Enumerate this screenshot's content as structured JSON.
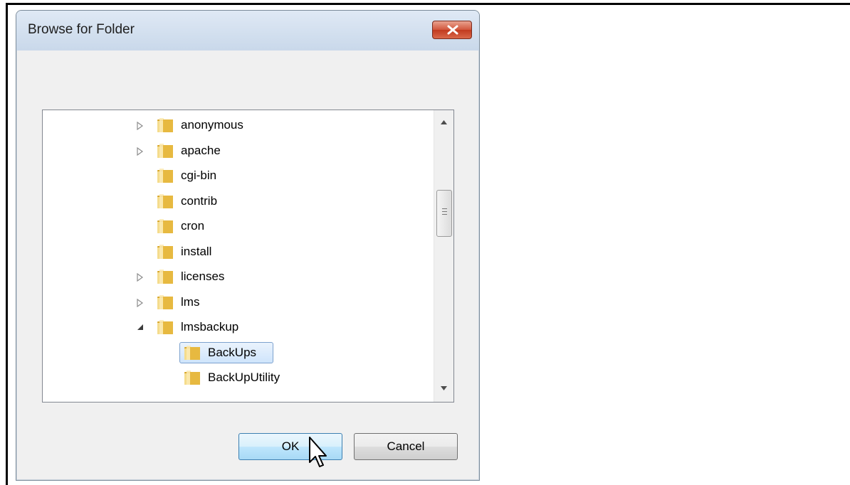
{
  "dialog": {
    "title": "Browse for Folder",
    "close_icon": "close-x-icon",
    "ok_label": "OK",
    "cancel_label": "Cancel"
  },
  "tree": {
    "items": [
      {
        "label": "anonymous",
        "expander": "collapsed",
        "indent": 0
      },
      {
        "label": "apache",
        "expander": "collapsed",
        "indent": 0
      },
      {
        "label": "cgi-bin",
        "expander": "none",
        "indent": 0
      },
      {
        "label": "contrib",
        "expander": "none",
        "indent": 0
      },
      {
        "label": "cron",
        "expander": "none",
        "indent": 0
      },
      {
        "label": "install",
        "expander": "none",
        "indent": 0
      },
      {
        "label": "licenses",
        "expander": "collapsed",
        "indent": 0
      },
      {
        "label": "lms",
        "expander": "collapsed",
        "indent": 0
      },
      {
        "label": "lmsbackup",
        "expander": "expanded",
        "indent": 0
      },
      {
        "label": "BackUps",
        "expander": "none",
        "indent": 1,
        "selected": true
      },
      {
        "label": "BackUpUtility",
        "expander": "none",
        "indent": 1
      }
    ]
  },
  "colors": {
    "folder_light": "#f5dc8c",
    "folder_dark": "#d9a82e",
    "selection_border": "#7da2ce"
  }
}
